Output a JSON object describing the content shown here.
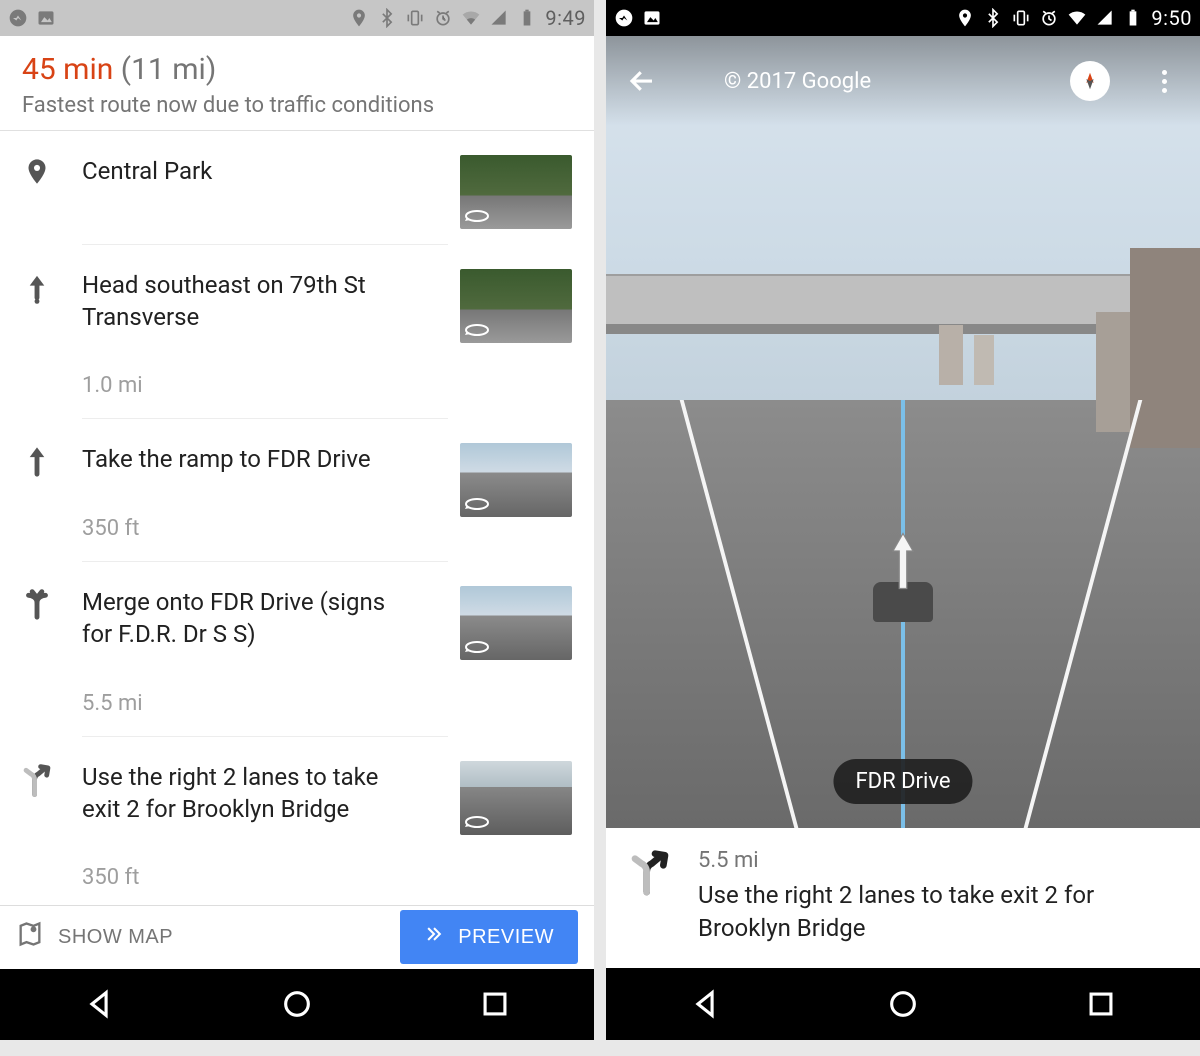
{
  "left": {
    "status": {
      "time": "9:49"
    },
    "route": {
      "time": "45 min",
      "distance": "(11 mi)",
      "subtitle": "Fastest route now due to traffic conditions"
    },
    "steps": [
      {
        "icon": "pin",
        "text": "Central Park",
        "dist": "",
        "thumb": "park"
      },
      {
        "icon": "depart",
        "text": "Head southeast on 79th St Transverse",
        "dist": "1.0 mi",
        "thumb": "park"
      },
      {
        "icon": "straight",
        "text": "Take the ramp to FDR Drive",
        "dist": "350 ft",
        "thumb": "city"
      },
      {
        "icon": "merge",
        "text": "Merge onto FDR Drive (signs for F.D.R. Dr S S)",
        "dist": "5.5 mi",
        "thumb": "city"
      },
      {
        "icon": "fork-r",
        "text": "Use the right 2 lanes to take exit 2 for Brooklyn Bridge",
        "dist": "350 ft",
        "thumb": "bridge"
      }
    ],
    "bottom": {
      "show_map_label": "SHOW MAP",
      "preview_label": "PREVIEW"
    }
  },
  "right": {
    "status": {
      "time": "9:50"
    },
    "streetview": {
      "copyright": "© 2017 Google",
      "road_label": "FDR Drive"
    },
    "direction": {
      "dist": "5.5 mi",
      "text": "Use the right 2 lanes to take exit 2 for Brooklyn Bridge"
    }
  }
}
